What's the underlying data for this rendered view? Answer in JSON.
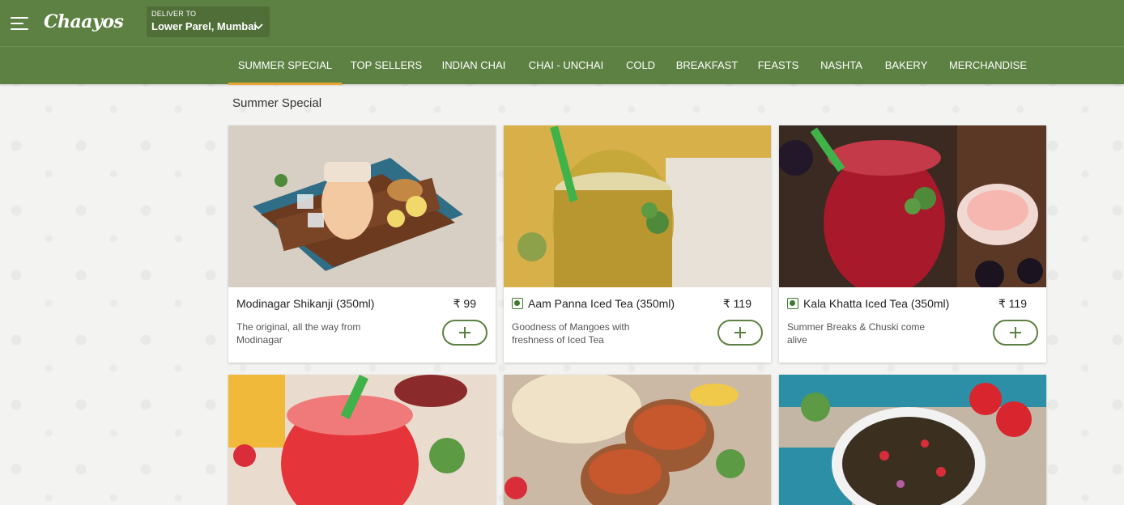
{
  "header": {
    "logo_text": "Chaayos",
    "deliver_label": "DELIVER TO",
    "location": "Lower Parel, Mumbai",
    "bg_color": "#5d8043"
  },
  "nav": {
    "tabs": [
      {
        "label": "SUMMER SPECIAL",
        "active": true
      },
      {
        "label": "TOP SELLERS"
      },
      {
        "label": "INDIAN CHAI"
      },
      {
        "label": "CHAI - UNCHAI"
      },
      {
        "label": "COLD"
      },
      {
        "label": "BREAKFAST"
      },
      {
        "label": "FEASTS"
      },
      {
        "label": "NASHTA"
      },
      {
        "label": "BAKERY"
      },
      {
        "label": "MERCHANDISE"
      }
    ],
    "active_color": "#e8a634"
  },
  "section": {
    "title": "Summer Special"
  },
  "products": [
    {
      "name": "Modinagar Shikanji (350ml)",
      "price": "₹ 99",
      "description": "The original, all the way from Modinagar",
      "veg": false
    },
    {
      "name": "Aam Panna Iced Tea (350ml)",
      "price": "₹ 119",
      "description": "Goodness of Mangoes with freshness of Iced Tea",
      "veg": true
    },
    {
      "name": "Kala Khatta Iced Tea (350ml)",
      "price": "₹ 119",
      "description": "Summer Breaks & Chuski come alive",
      "veg": true
    }
  ]
}
